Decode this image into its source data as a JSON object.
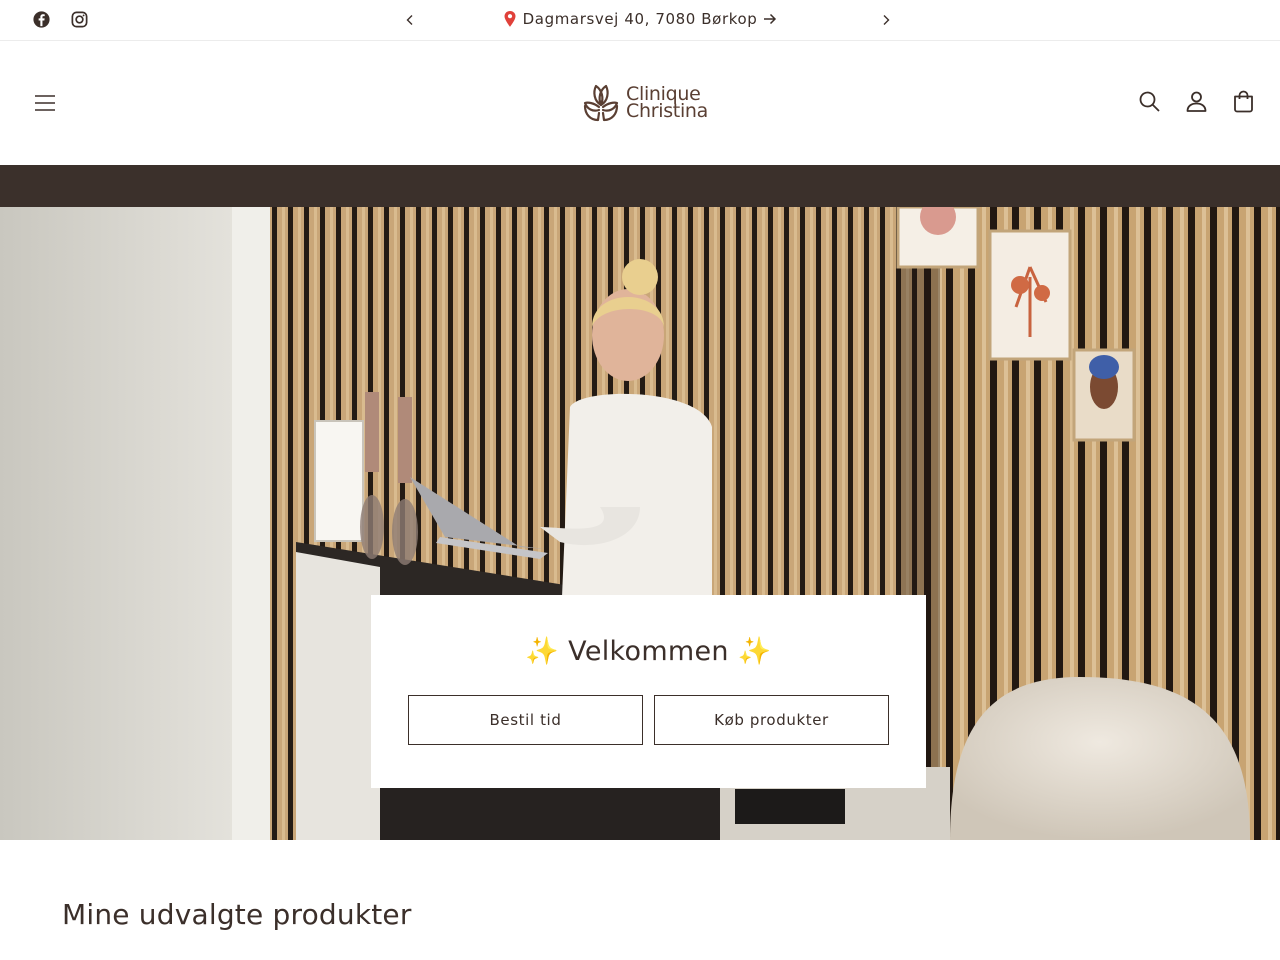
{
  "announcement": {
    "text": "Dagmarsvej 40, 7080 Børkop",
    "pin_icon": "pin-icon",
    "arrow_icon": "arrow-right-icon",
    "prev_icon": "chevron-left-icon",
    "next_icon": "chevron-right-icon"
  },
  "social": [
    "facebook-icon",
    "instagram-icon"
  ],
  "header": {
    "logo_line1": "Clinique",
    "logo_line2": "Christina",
    "icons": [
      "menu-icon",
      "search-icon",
      "account-icon",
      "cart-icon"
    ]
  },
  "hero": {
    "welcome_title": "✨ Velkommen ✨",
    "button_book": "Bestil tid",
    "button_shop": "Køb produkter"
  },
  "featured": {
    "title": "Mine udvalgte produkter"
  },
  "colors": {
    "text": "#3b2f2a",
    "band": "#3b302b",
    "logo": "#5a3f33"
  }
}
